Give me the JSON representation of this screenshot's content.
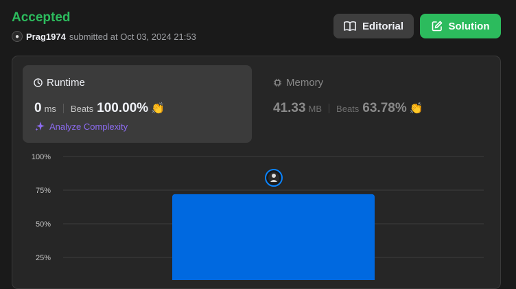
{
  "header": {
    "status": "Accepted",
    "username": "Prag1974",
    "submitted_text": "submitted at Oct 03, 2024 21:53",
    "editorial_label": "Editorial",
    "solution_label": "Solution"
  },
  "runtime": {
    "title": "Runtime",
    "value": "0",
    "unit": "ms",
    "beats_label": "Beats",
    "beats_value": "100.00%",
    "analyze_label": "Analyze Complexity"
  },
  "memory": {
    "title": "Memory",
    "value": "41.33",
    "unit": "MB",
    "beats_label": "Beats",
    "beats_value": "63.78%"
  },
  "colors": {
    "accepted": "#2cbb5d",
    "bar": "#0069e0",
    "analyze": "#8c6bf0"
  },
  "chart_data": {
    "type": "bar",
    "y_ticks": [
      "100%",
      "75%",
      "50%",
      "25%"
    ],
    "ylim": [
      0,
      100
    ],
    "values": [
      72
    ],
    "grid": true
  }
}
